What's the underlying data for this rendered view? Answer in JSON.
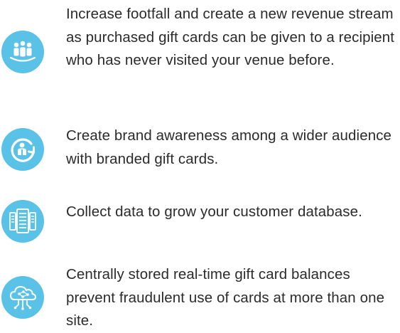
{
  "theme": {
    "icon_color": "#5bc2e7",
    "text_color": "#2b2b2b"
  },
  "benefits": [
    {
      "icon": "people-group-icon",
      "text": "Increase footfall and create a new revenue stream as purchased gift cards can be given to a recipient who has never visited your venue before."
    },
    {
      "icon": "audience-reach-icon",
      "text": "Create brand awareness among a wider audience with branded gift cards."
    },
    {
      "icon": "database-servers-icon",
      "text": "Collect data to grow your customer database."
    },
    {
      "icon": "cloud-network-icon",
      "text": "Centrally stored real-time gift card balances prevent fraudulent use of cards at more than one site."
    }
  ]
}
